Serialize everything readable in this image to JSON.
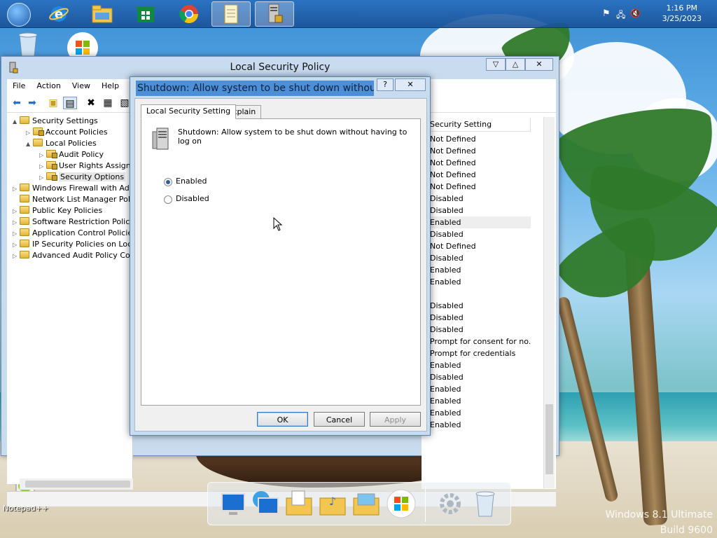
{
  "taskbar": {
    "apps": [
      {
        "name": "ie-icon",
        "active": false
      },
      {
        "name": "file-explorer-icon",
        "active": false
      },
      {
        "name": "store-icon",
        "active": false
      },
      {
        "name": "chrome-icon",
        "active": false
      },
      {
        "name": "notepad-icon",
        "active": true
      },
      {
        "name": "security-policy-icon",
        "active": true
      }
    ],
    "clock_time": "1:16 PM",
    "clock_date": "3/25/2023"
  },
  "desktop": {
    "notepad_label": "Notepad++"
  },
  "main_window": {
    "title": "Local Security Policy",
    "menu": [
      "File",
      "Action",
      "View",
      "Help"
    ],
    "tree": [
      {
        "label": "Security Settings",
        "level": 0,
        "expander": "▲"
      },
      {
        "label": "Account Policies",
        "level": 1,
        "expander": "▷"
      },
      {
        "label": "Local Policies",
        "level": 1,
        "expander": "▲"
      },
      {
        "label": "Audit Policy",
        "level": 2,
        "expander": "▷"
      },
      {
        "label": "User Rights Assignment",
        "level": 2,
        "expander": "▷"
      },
      {
        "label": "Security Options",
        "level": 2,
        "expander": "▷",
        "selected": true
      },
      {
        "label": "Windows Firewall with Advanced Security",
        "level": 0,
        "expander": "▷"
      },
      {
        "label": "Network List Manager Policies",
        "level": 0,
        "expander": ""
      },
      {
        "label": "Public Key Policies",
        "level": 0,
        "expander": "▷"
      },
      {
        "label": "Software Restriction Policies",
        "level": 0,
        "expander": "▷"
      },
      {
        "label": "Application Control Policies",
        "level": 0,
        "expander": "▷"
      },
      {
        "label": "IP Security Policies on Local Computer",
        "level": 0,
        "expander": "▷"
      },
      {
        "label": "Advanced Audit Policy Configuration",
        "level": 0,
        "expander": "▷"
      }
    ],
    "column_header": "Security Setting",
    "rows": [
      "Not Defined",
      "Not Defined",
      "Not Defined",
      "Not Defined",
      "Not Defined",
      "Disabled",
      "Disabled",
      "Enabled",
      "Disabled",
      "Not Defined",
      "Disabled",
      "Enabled",
      "Enabled",
      "",
      "Disabled",
      "Disabled",
      "Disabled",
      "Prompt for consent for no...",
      "Prompt for credentials",
      "Enabled",
      "Disabled",
      "Enabled",
      "Enabled",
      "Enabled",
      "Enabled"
    ],
    "highlight_row": 7
  },
  "dialog": {
    "title": "Shutdown: Allow system to be shut down without ...",
    "help_label": "?",
    "close_label": "✕",
    "tabs": [
      "Local Security Setting",
      "Explain"
    ],
    "description": "Shutdown: Allow system to be shut down without having to log on",
    "options": [
      {
        "label": "Enabled",
        "selected": true
      },
      {
        "label": "Disabled",
        "selected": false
      }
    ],
    "ok_label": "OK",
    "cancel_label": "Cancel",
    "apply_label": "Apply"
  },
  "watermark": {
    "line1": "Windows 8.1 Ultimate",
    "line2": "Build 9600"
  }
}
